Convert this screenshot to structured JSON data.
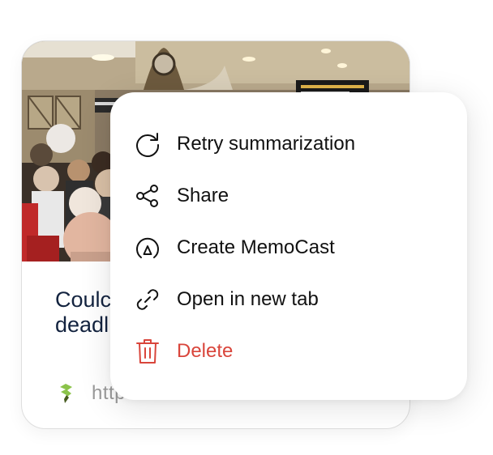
{
  "card": {
    "title": "Could … deadl…",
    "title_line1": "Coulc",
    "title_line2": "deadl",
    "source_url": "https://",
    "source_icon": "site-favicon-icon"
  },
  "menu": {
    "items": [
      {
        "label": "Retry summarization",
        "icon": "refresh-icon"
      },
      {
        "label": "Share",
        "icon": "share-icon"
      },
      {
        "label": "Create MemoCast",
        "icon": "memocast-icon"
      },
      {
        "label": "Open in new tab",
        "icon": "link-icon"
      },
      {
        "label": "Delete",
        "icon": "trash-icon",
        "color": "#d9453b"
      }
    ]
  },
  "colors": {
    "title": "#13233f",
    "danger": "#d9453b",
    "muted": "#9a9a9a"
  }
}
